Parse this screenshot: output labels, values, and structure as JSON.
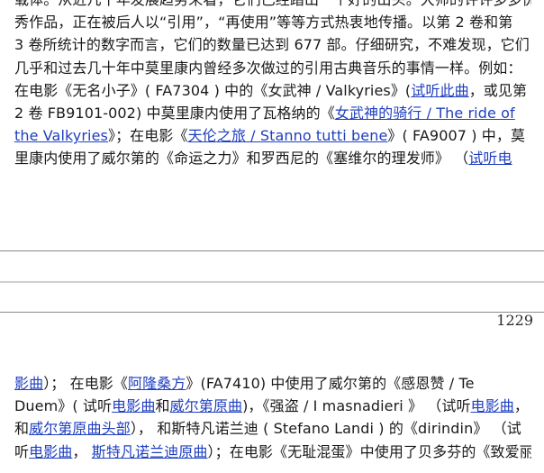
{
  "top": {
    "lines": [
      [
        {
          "t": "载体。从近几十年发展趋势来看，它们已经踏出一个好的出头。大师的许许多多优"
        }
      ],
      [
        {
          "t": "秀作品，正在被后人以“引用”，“再使用”等等方式热衷地传播。以第 2 卷和第"
        }
      ],
      [
        {
          "t": "3 卷所统计的数字而言，它们的数量已达到 677 部。仔细研究，不难发现，它们"
        }
      ],
      [
        {
          "t": "几乎和过去几十年中莫里康内曾经多次做过的引用古典音乐的事情一样。例如："
        }
      ],
      [
        {
          "t": "在电影《无名小子》( FA7304 ) 中的《女武神 / Valkyries》("
        },
        {
          "t": "试听此曲",
          "link": true
        },
        {
          "t": "，或见第"
        }
      ],
      [
        {
          "t": " 2 卷 FB9101-002) 中莫里康内使用了瓦格纳的《"
        },
        {
          "t": "女武神的骑行 / The ride of",
          "link": true
        }
      ],
      [
        {
          "t": "the Valkyries",
          "link": true
        },
        {
          "t": "》；在电影《"
        },
        {
          "t": "天伦之旅 / Stanno tutti bene",
          "link": true
        },
        {
          "t": "》( FA9007 ) 中，莫"
        }
      ],
      [
        {
          "t": "里康内使用了威尔第的《命运之力》和罗西尼的《塞维尔的理发师》 （"
        },
        {
          "t": "试听电",
          "link": true
        }
      ]
    ]
  },
  "page_number": "1229",
  "bottom": {
    "lines": [
      [
        {
          "t": "   "
        },
        {
          "t": "影曲",
          "link": true
        },
        {
          "t": "）；  在电影《"
        },
        {
          "t": "阿隆桑方",
          "link": true
        },
        {
          "t": "》(FA7410) 中使用了威尔第的《感恩赞 / Te"
        }
      ],
      [
        {
          "t": "Duem》( 试听"
        },
        {
          "t": "电影曲",
          "link": true
        },
        {
          "t": "和"
        },
        {
          "t": "威尔第原曲",
          "link": true
        },
        {
          "t": ")，《强盗 / I masnadieri 》 （试听"
        },
        {
          "t": "电影曲",
          "link": true
        },
        {
          "t": "，"
        }
      ],
      [
        {
          "t": "和"
        },
        {
          "t": "威尔第原曲头部",
          "link": true
        },
        {
          "t": "），  和斯特凡诺兰迪 ( Stefano Landi ) 的《dirindin》 （试"
        }
      ],
      [
        {
          "t": "听"
        },
        {
          "t": "电影曲",
          "link": true
        },
        {
          "t": "，  "
        },
        {
          "t": "斯特凡诺兰迪原曲",
          "link": true
        },
        {
          "t": "）；在电影《无耻混蛋》中使用了贝多芬的《致爱丽"
        }
      ]
    ]
  }
}
